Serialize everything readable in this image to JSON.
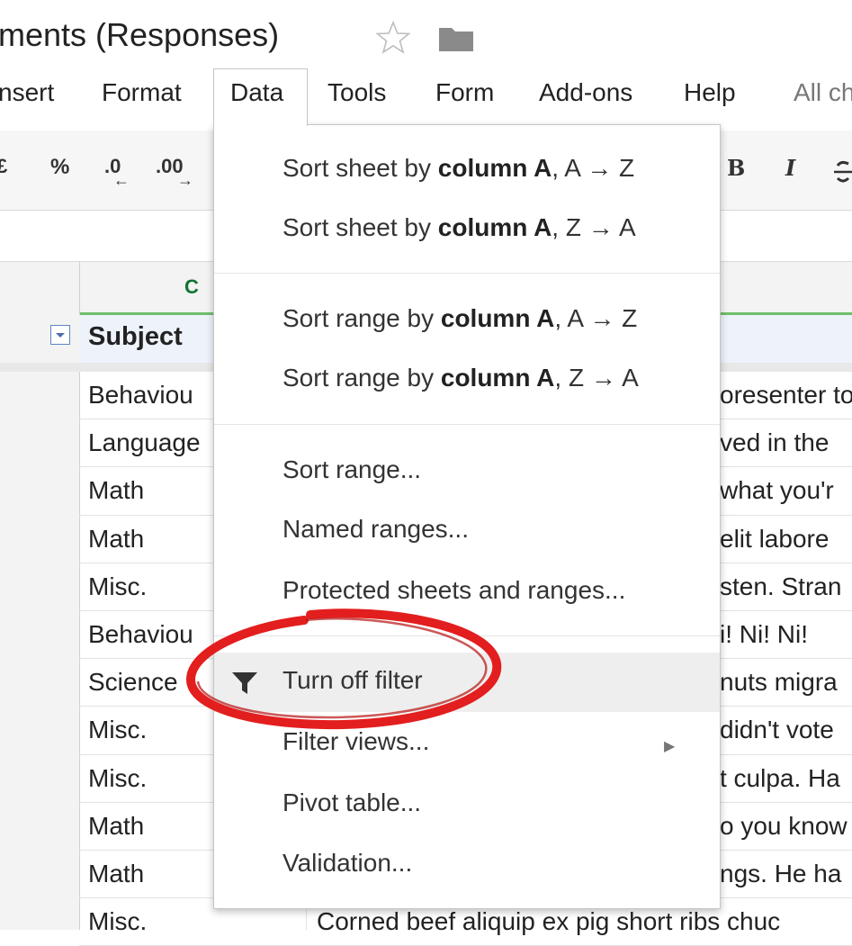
{
  "title": {
    "doc_name": "ments (Responses)",
    "star_icon": "star-outline-icon",
    "folder_icon": "folder-icon"
  },
  "menubar": {
    "items": [
      "nsert",
      "Format",
      "Data",
      "Tools",
      "Form",
      "Add-ons",
      "Help"
    ],
    "status": "All ch"
  },
  "toolbar": {
    "currency": "£",
    "percent": "%",
    "decrease_decimals": ".0",
    "increase_decimals": ".00",
    "bold": "B",
    "italic": "I"
  },
  "grid": {
    "column_c": "C",
    "header_subject": "Subject",
    "subjects": [
      "Behaviou",
      "Language",
      "Math",
      "Math",
      "Misc.",
      "Behaviou",
      "Science",
      "Misc.",
      "Misc.",
      "Math",
      "Math",
      "Misc."
    ],
    "column_d_fragments": [
      "oresenter to",
      "ved in the",
      "what you'r",
      "elit labore",
      "sten. Stran",
      "i! Ni! Ni!",
      "nuts migra",
      "didn't vote",
      "t culpa. Ha",
      "o you know",
      "ngs. He ha",
      "Corned beef aliquip ex pig short ribs chuc"
    ]
  },
  "data_menu": {
    "sort_sheet_az": {
      "prefix": "Sort sheet by ",
      "bold": "column A",
      "suffix": ", A → Z"
    },
    "sort_sheet_za": {
      "prefix": "Sort sheet by ",
      "bold": "column A",
      "suffix": ", Z → A"
    },
    "sort_range_az": {
      "prefix": "Sort range by ",
      "bold": "column A",
      "suffix": ", A → Z"
    },
    "sort_range_za": {
      "prefix": "Sort range by ",
      "bold": "column A",
      "suffix": ", Z → A"
    },
    "sort_range": "Sort range...",
    "named_ranges": "Named ranges...",
    "protected": "Protected sheets and ranges...",
    "turn_off_filter": "Turn off filter",
    "filter_views": "Filter views...",
    "pivot_table": "Pivot table...",
    "validation": "Validation...",
    "submenu_arrow": "▶"
  },
  "colors": {
    "annotation_red": "#e31e1e",
    "highlight": "#eeeeee",
    "header_green": "#6fbf6b"
  }
}
